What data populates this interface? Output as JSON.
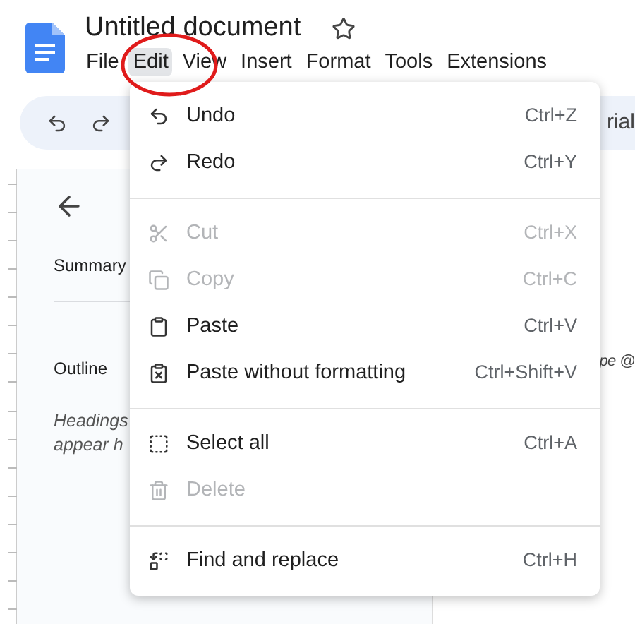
{
  "document": {
    "title": "Untitled document"
  },
  "menu_bar": [
    {
      "label": "File",
      "selected": false
    },
    {
      "label": "Edit",
      "selected": true
    },
    {
      "label": "View",
      "selected": false
    },
    {
      "label": "Insert",
      "selected": false
    },
    {
      "label": "Format",
      "selected": false
    },
    {
      "label": "Tools",
      "selected": false
    },
    {
      "label": "Extensions",
      "selected": false
    }
  ],
  "toolbar": {
    "font": "rial"
  },
  "outline_panel": {
    "summary": "Summary",
    "outline": "Outline",
    "hint_lines": [
      "Headings",
      "appear h"
    ]
  },
  "page_text": "pe @",
  "edit_menu": [
    {
      "kind": "item",
      "label": "Undo",
      "shortcut": "Ctrl+Z",
      "disabled": false
    },
    {
      "kind": "item",
      "label": "Redo",
      "shortcut": "Ctrl+Y",
      "disabled": false
    },
    {
      "kind": "divider"
    },
    {
      "kind": "item",
      "label": "Cut",
      "shortcut": "Ctrl+X",
      "disabled": true
    },
    {
      "kind": "item",
      "label": "Copy",
      "shortcut": "Ctrl+C",
      "disabled": true
    },
    {
      "kind": "item",
      "label": "Paste",
      "shortcut": "Ctrl+V",
      "disabled": false
    },
    {
      "kind": "item",
      "label": "Paste without formatting",
      "shortcut": "Ctrl+Shift+V",
      "disabled": false
    },
    {
      "kind": "divider"
    },
    {
      "kind": "item",
      "label": "Select all",
      "shortcut": "Ctrl+A",
      "disabled": false
    },
    {
      "kind": "item",
      "label": "Delete",
      "disabled": true
    },
    {
      "kind": "divider"
    },
    {
      "kind": "item",
      "label": "Find and replace",
      "shortcut": "Ctrl+H",
      "disabled": false
    }
  ]
}
